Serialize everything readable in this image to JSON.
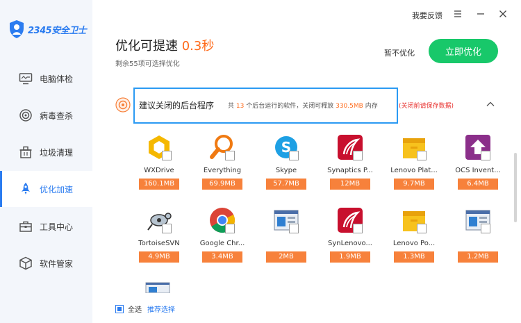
{
  "app": {
    "logo_text": "2345安全卫士"
  },
  "window": {
    "feedback_label": "我要反馈",
    "menu_glyph": "☰",
    "minimize_glyph": "─",
    "close_glyph": "✕"
  },
  "sidebar": {
    "items": [
      {
        "label": "电脑体检",
        "icon": "monitor-icon",
        "active": false
      },
      {
        "label": "病毒查杀",
        "icon": "target-icon",
        "active": false
      },
      {
        "label": "垃圾清理",
        "icon": "trash-icon",
        "active": false
      },
      {
        "label": "优化加速",
        "icon": "rocket-icon",
        "active": true
      },
      {
        "label": "工具中心",
        "icon": "toolbox-icon",
        "active": false
      },
      {
        "label": "软件管家",
        "icon": "box-icon",
        "active": false
      }
    ]
  },
  "header": {
    "title_prefix": "优化可提速",
    "title_speed": "0.3秒",
    "subtitle": "剩余55项可选择优化",
    "skip_label": "暂不优化",
    "optimize_label": "立即优化"
  },
  "section": {
    "title": "建议关闭的后台程序",
    "desc_prefix": "共",
    "count": "13",
    "desc_mid": "个后台运行的软件，关闭可释放",
    "release": "330.5MB",
    "desc_suffix": "内存",
    "warning": "(关闭前请保存数据)"
  },
  "apps": [
    {
      "name": "WXDrive",
      "size": "160.1MB",
      "icon": "wxdrive-icon"
    },
    {
      "name": "Everything",
      "size": "69.9MB",
      "icon": "magnifier-icon"
    },
    {
      "name": "Skype",
      "size": "57.7MB",
      "icon": "skype-icon"
    },
    {
      "name": "Synaptics P...",
      "size": "12MB",
      "icon": "synaptics-icon"
    },
    {
      "name": "Lenovo Plat...",
      "size": "9.7MB",
      "icon": "folder-icon"
    },
    {
      "name": "OCS Invent...",
      "size": "6.4MB",
      "icon": "ocs-icon"
    },
    {
      "name": "TortoiseSVN",
      "size": "4.9MB",
      "icon": "tortoise-icon"
    },
    {
      "name": "Google Chr...",
      "size": "3.4MB",
      "icon": "chrome-icon"
    },
    {
      "name": "",
      "size": "2MB",
      "icon": "window-icon"
    },
    {
      "name": "SynLenovo...",
      "size": "1.9MB",
      "icon": "synaptics-icon"
    },
    {
      "name": "Lenovo Po...",
      "size": "1.3MB",
      "icon": "folder-icon"
    },
    {
      "name": "",
      "size": "1.2MB",
      "icon": "window-icon"
    }
  ],
  "footer": {
    "select_all": "全选",
    "recommend": "推荐选择"
  },
  "colors": {
    "accent": "#2b7cf0",
    "orange": "#f7813b",
    "green": "#18c86a",
    "warning": "#e8322f"
  }
}
